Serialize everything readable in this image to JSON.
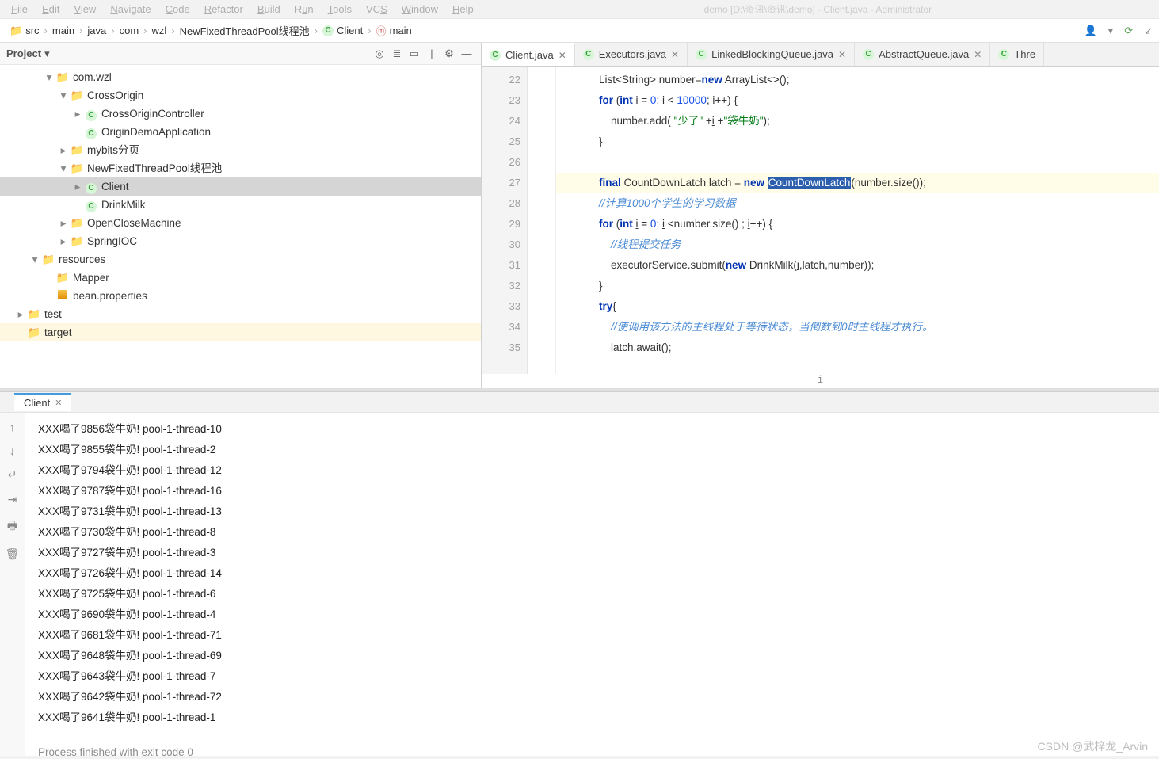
{
  "title_suffix": "demo [D:\\资讯\\资讯\\demo] - Client.java - Administrator",
  "menu": [
    "File",
    "Edit",
    "View",
    "Navigate",
    "Code",
    "Refactor",
    "Build",
    "Run",
    "Tools",
    "VCS",
    "Window",
    "Help"
  ],
  "breadcrumb": {
    "items": [
      {
        "kind": "folder",
        "label": "src"
      },
      {
        "kind": "folder",
        "label": "main"
      },
      {
        "kind": "folder",
        "label": "java"
      },
      {
        "kind": "folder",
        "label": "com"
      },
      {
        "kind": "folder",
        "label": "wzl"
      },
      {
        "kind": "folder",
        "label": "NewFixedThreadPool线程池"
      },
      {
        "kind": "class",
        "label": "Client"
      },
      {
        "kind": "method",
        "label": "main"
      }
    ]
  },
  "project": {
    "title": "Project",
    "tree": [
      {
        "indent": 3,
        "exp": "down",
        "icon": "pkg",
        "label": "com.wzl"
      },
      {
        "indent": 4,
        "exp": "down",
        "icon": "pkg",
        "label": "CrossOrigin"
      },
      {
        "indent": 5,
        "exp": "right",
        "icon": "class",
        "label": "CrossOriginController"
      },
      {
        "indent": 5,
        "exp": "",
        "icon": "class",
        "label": "OriginDemoApplication"
      },
      {
        "indent": 4,
        "exp": "right",
        "icon": "pkg",
        "label": "mybits分页"
      },
      {
        "indent": 4,
        "exp": "down",
        "icon": "pkg",
        "label": "NewFixedThreadPool线程池"
      },
      {
        "indent": 5,
        "exp": "right",
        "icon": "class",
        "label": "Client",
        "sel": true
      },
      {
        "indent": 5,
        "exp": "",
        "icon": "class",
        "label": "DrinkMilk"
      },
      {
        "indent": 4,
        "exp": "right",
        "icon": "pkg",
        "label": "OpenCloseMachine"
      },
      {
        "indent": 4,
        "exp": "right",
        "icon": "pkg",
        "label": "SpringIOC"
      },
      {
        "indent": 2,
        "exp": "down",
        "icon": "resfolder",
        "label": "resources"
      },
      {
        "indent": 3,
        "exp": "",
        "icon": "pkg",
        "label": "Mapper"
      },
      {
        "indent": 3,
        "exp": "",
        "icon": "prop",
        "label": "bean.properties"
      },
      {
        "indent": 1,
        "exp": "right",
        "icon": "folder",
        "label": "test"
      },
      {
        "indent": 1,
        "exp": "",
        "icon": "target",
        "label": "target",
        "target": true
      }
    ]
  },
  "editor": {
    "tabs": [
      {
        "label": "Client.java",
        "icon": "class",
        "active": true,
        "closable": true
      },
      {
        "label": "Executors.java",
        "icon": "class",
        "closable": true
      },
      {
        "label": "LinkedBlockingQueue.java",
        "icon": "class",
        "closable": true
      },
      {
        "label": "AbstractQueue.java",
        "icon": "class",
        "closable": true
      },
      {
        "label": "Thre",
        "icon": "class",
        "closable": false
      }
    ],
    "first_line": 22,
    "highlight_line": 27,
    "lines": [
      {
        "html": "        List&lt;String&gt; number=<span class='kw'>new</span> ArrayList&lt;&gt;();"
      },
      {
        "html": "        <span class='kw'>for</span> (<span class='kw'>int</span> <u>i</u> = <span class='num'>0</span>; <u>i</u> &lt; <span class='num'>10000</span>; <u>i</u>++) {"
      },
      {
        "html": "            number.add( <span class='str'>\"少了\"</span> +<u>i</u> +<span class='str'>\"袋牛奶\"</span>);"
      },
      {
        "html": "        }"
      },
      {
        "html": ""
      },
      {
        "html": "        <span class='kw'>final</span> CountDownLatch latch = <span class='kw'>new</span> <span class='sel-word'>CountDownLatch</span>(number.size());"
      },
      {
        "html": "        <span class='cmt-cn'>//计算1000个学生的学习数据</span>"
      },
      {
        "html": "        <span class='kw'>for</span> (<span class='kw'>int</span> <u>i</u> = <span class='num'>0</span>; <u>i</u> &lt;number.size() ; <u>i</u>++) {"
      },
      {
        "html": "            <span class='cmt-cn'>//线程提交任务</span>"
      },
      {
        "html": "            executorService.submit(<span class='kw'>new</span> DrinkMilk(<u>i</u>,latch,number));"
      },
      {
        "html": "        }"
      },
      {
        "html": "        <span class='kw'>try</span>{"
      },
      {
        "html": "            <span class='cmt-cn'>//使调用该方法的主线程处于等待状态，当倒数到0时主线程才执行。</span>"
      },
      {
        "html": "            latch.await();"
      }
    ],
    "caret_col_label": "i"
  },
  "run": {
    "tab_label": "Client",
    "output": [
      "XXX喝了9856袋牛奶! pool-1-thread-10",
      "XXX喝了9855袋牛奶! pool-1-thread-2",
      "XXX喝了9794袋牛奶! pool-1-thread-12",
      "XXX喝了9787袋牛奶! pool-1-thread-16",
      "XXX喝了9731袋牛奶! pool-1-thread-13",
      "XXX喝了9730袋牛奶! pool-1-thread-8",
      "XXX喝了9727袋牛奶! pool-1-thread-3",
      "XXX喝了9726袋牛奶! pool-1-thread-14",
      "XXX喝了9725袋牛奶! pool-1-thread-6",
      "XXX喝了9690袋牛奶! pool-1-thread-4",
      "XXX喝了9681袋牛奶! pool-1-thread-71",
      "XXX喝了9648袋牛奶! pool-1-thread-69",
      "XXX喝了9643袋牛奶! pool-1-thread-7",
      "XXX喝了9642袋牛奶! pool-1-thread-72",
      "XXX喝了9641袋牛奶! pool-1-thread-1"
    ],
    "exit_line": "Process finished with exit code 0"
  },
  "watermark": "CSDN @武梓龙_Arvin"
}
